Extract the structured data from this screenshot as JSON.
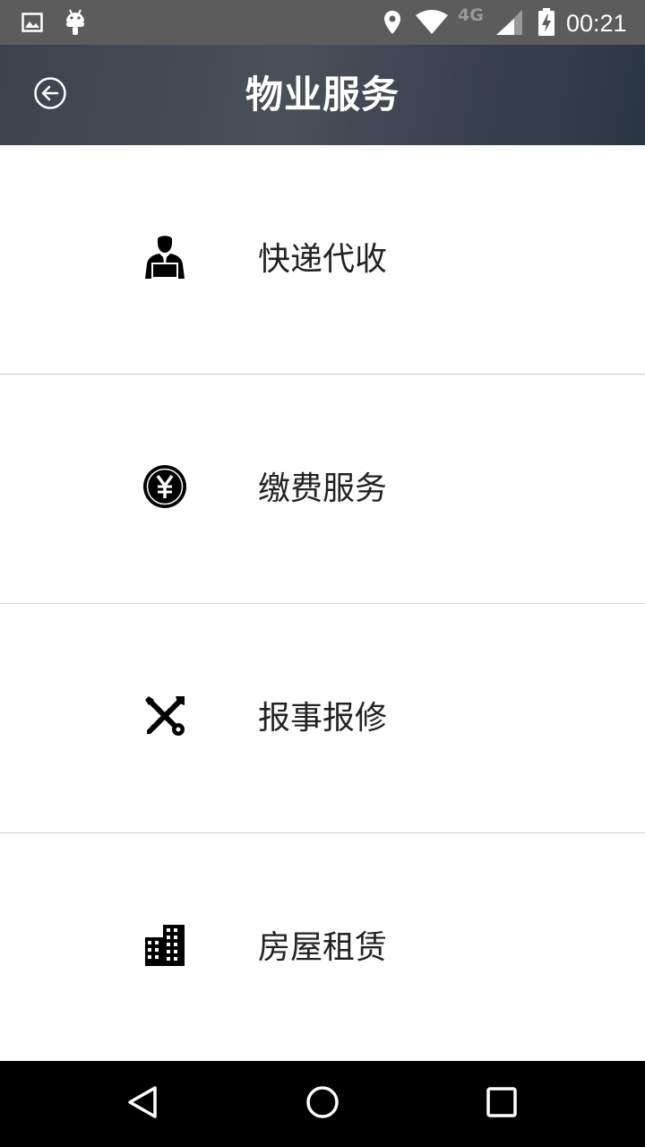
{
  "status_bar": {
    "network": "4G",
    "time": "00:21",
    "icons": [
      "gallery-icon",
      "android-icon",
      "location-icon",
      "wifi-icon",
      "signal-icon",
      "battery-charging-icon"
    ]
  },
  "header": {
    "title": "物业服务",
    "back_icon": "circle-arrow-left-icon"
  },
  "services": [
    {
      "label": "快递代收",
      "icon": "courier-person-icon"
    },
    {
      "label": "缴费服务",
      "icon": "yuan-coin-icon"
    },
    {
      "label": "报事报修",
      "icon": "wrench-screwdriver-icon"
    },
    {
      "label": "房屋租赁",
      "icon": "buildings-icon"
    }
  ],
  "nav_bar": {
    "icons": [
      "nav-back-icon",
      "nav-home-icon",
      "nav-recent-icon"
    ]
  },
  "colors": {
    "status_bar_bg": "#5c5c5c",
    "title_bar_bg": "#3d434c",
    "text": "#222222",
    "divider": "#cfcfcf",
    "nav_bar_bg": "#000000"
  }
}
